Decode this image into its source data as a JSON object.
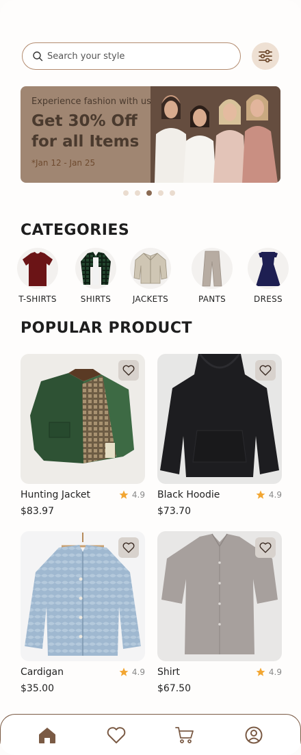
{
  "search": {
    "placeholder": "Search your style"
  },
  "banner": {
    "subtitle": "Experience fashion with us",
    "title": "Get 30% Off for all Items",
    "date": "*Jan 12 - Jan 25",
    "slide_count": 5,
    "active_slide": 3
  },
  "categories": {
    "title": "CATEGORIES",
    "items": [
      {
        "label": "T-SHIRTS",
        "icon": "tshirt-icon"
      },
      {
        "label": "SHIRTS",
        "icon": "shirt-icon"
      },
      {
        "label": "JACKETS",
        "icon": "jacket-icon"
      },
      {
        "label": "PANTS",
        "icon": "pants-icon"
      },
      {
        "label": "DRESS",
        "icon": "dress-icon"
      }
    ]
  },
  "popular": {
    "title": "POPULAR PRODUCT",
    "items": [
      {
        "name": "Hunting Jacket",
        "rating": "4.9",
        "price": "$83.97"
      },
      {
        "name": "Black Hoodie",
        "rating": "4.9",
        "price": "$73.70"
      },
      {
        "name": "Cardigan",
        "rating": "4.9",
        "price": "$35.00"
      },
      {
        "name": "Shirt",
        "rating": "4.9",
        "price": "$67.50"
      }
    ]
  },
  "nav": [
    "home-icon",
    "heart-icon",
    "cart-icon",
    "profile-icon"
  ],
  "colors": {
    "accent": "#7a5a44",
    "star": "#f2a632",
    "banner_bg": "#a08672"
  }
}
